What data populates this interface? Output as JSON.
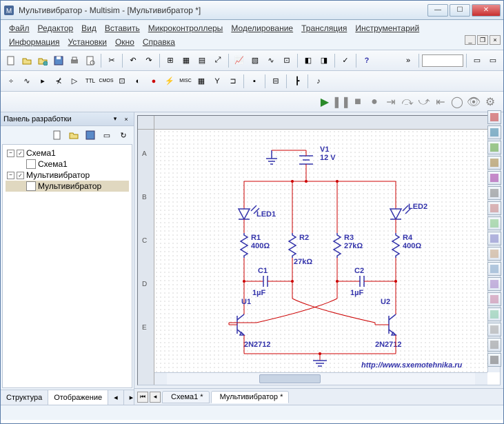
{
  "window": {
    "title": "Мультивибратор - Multisim - [Мультивибратор *]"
  },
  "menu": {
    "items": [
      "Файл",
      "Редактор",
      "Вид",
      "Вставить",
      "Микроконтроллеры",
      "Моделирование",
      "Трансляция",
      "Инструментарий",
      "Информация",
      "Установки",
      "Окно",
      "Справка"
    ]
  },
  "sidebar": {
    "title": "Панель разработки",
    "tree": {
      "root1": "Схема1",
      "child1": "Схема1",
      "root2": "Мультивибратор",
      "child2": "Мультивибратор"
    },
    "tabs": {
      "structure": "Структура",
      "display": "Отображение"
    }
  },
  "schematic": {
    "V1": {
      "name": "V1",
      "value": "12 V"
    },
    "LED1": "LED1",
    "LED2": "LED2",
    "R1": {
      "name": "R1",
      "value": "400Ω"
    },
    "R2": {
      "name": "R2",
      "value": "27kΩ"
    },
    "R3": {
      "name": "R3",
      "value": "27kΩ"
    },
    "R4": {
      "name": "R4",
      "value": "400Ω"
    },
    "C1": {
      "name": "C1",
      "value": "1µF"
    },
    "C2": {
      "name": "C2",
      "value": "1µF"
    },
    "U1": "U1",
    "U2": "U2",
    "Q1": "2N2712",
    "Q2": "2N2712",
    "url": "http://www.sxemotehnika.ru"
  },
  "doc_tabs": {
    "tab1": "Схема1 *",
    "tab2": "Мультивибратор *"
  },
  "ruler_v": [
    "A",
    "B",
    "C",
    "D",
    "E"
  ]
}
